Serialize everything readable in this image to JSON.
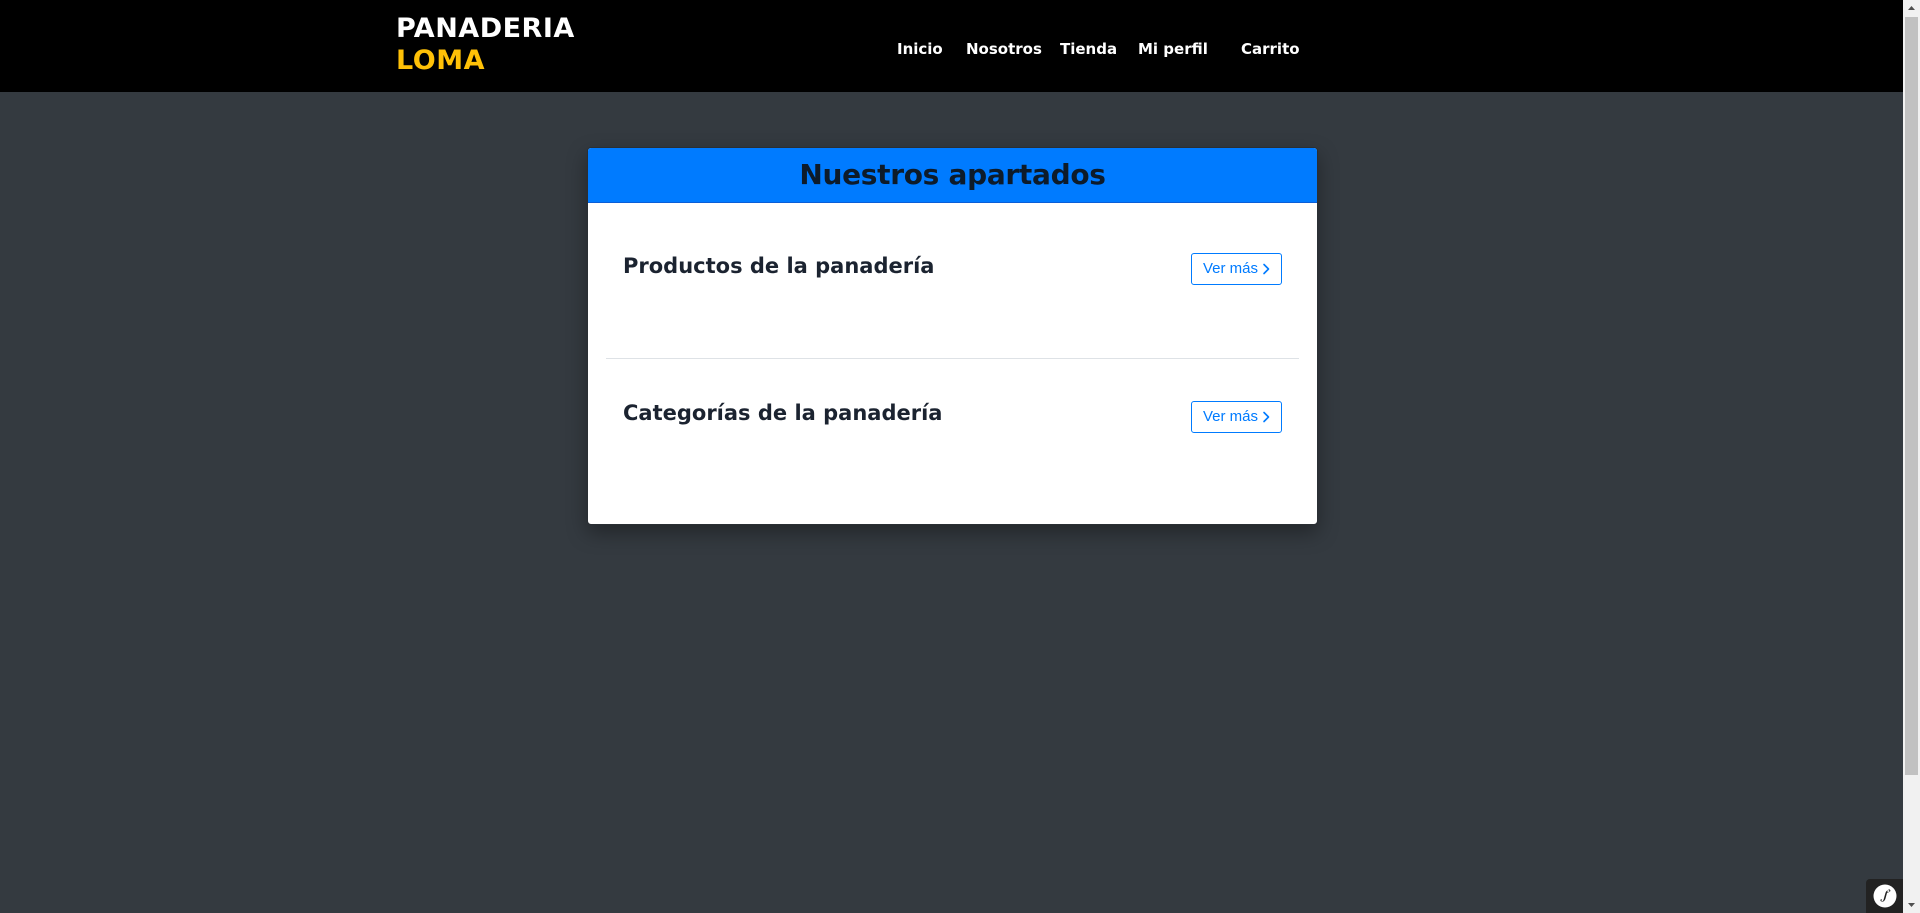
{
  "brand": {
    "line1": "PANADERIA",
    "line2": "LOMA"
  },
  "nav": {
    "inicio": "Inicio",
    "nosotros": "Nosotros",
    "tienda": "Tienda",
    "perfil": "Mi perfil",
    "carrito": "Carrito"
  },
  "card": {
    "title": "Nuestros apartados",
    "sections": [
      {
        "title": "Productos de la panadería",
        "button": "Ver más"
      },
      {
        "title": "Categorías de la panadería",
        "button": "Ver más"
      }
    ]
  },
  "icons": {
    "button_chevron": "chevron-right-icon",
    "toolbar": "symfony-logo-icon"
  },
  "colors": {
    "navbar": "#000000",
    "brand_accent": "#ffc107",
    "header": "#007bff",
    "page_background": "#343a40",
    "button": "#007bff"
  }
}
